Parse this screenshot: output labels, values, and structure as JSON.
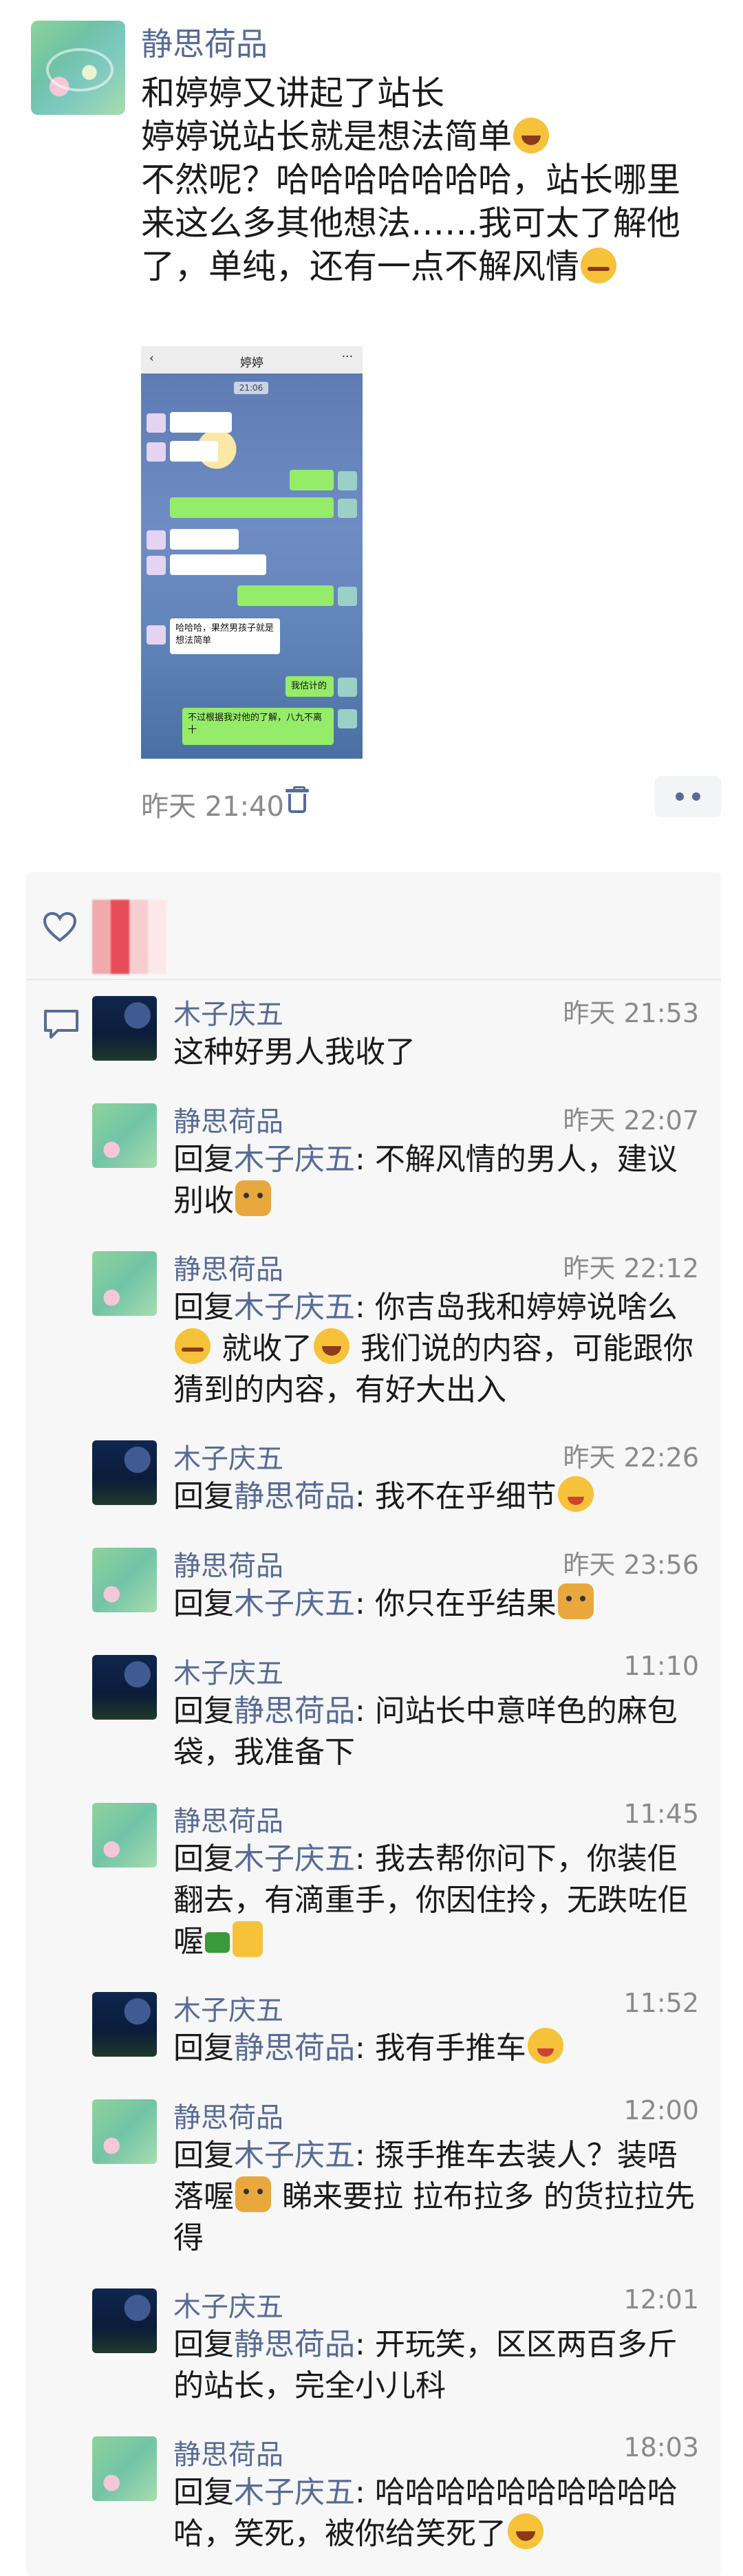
{
  "post": {
    "author": "静思荷品",
    "line1": "和婷婷又讲起了站长",
    "line2": "婷婷说站长就是想法简单",
    "line3": "不然呢？哈哈哈哈哈哈哈，站长哪里",
    "line4": "来这么多其他想法……我可太了解他",
    "line5": "了，单纯，还有一点不解风情",
    "time": "昨天 21:40"
  },
  "screenshot": {
    "title": "婷婷",
    "time": "21:06",
    "bubble1": "哈哈哈，果然男孩子就是想法简单",
    "bubble2": "我估计的",
    "bubble3": "不过根据我对他的了解，八九不离十"
  },
  "comments": [
    {
      "name": "木子庆五",
      "time": "昨天 21:53",
      "text": "这种好男人我收了"
    },
    {
      "name": "静思荷品",
      "time": "昨天 22:07",
      "reply_to": "木子庆五",
      "text": "不解风情的男人，建议别收"
    },
    {
      "name": "静思荷品",
      "time": "昨天 22:12",
      "reply_to": "木子庆五",
      "text": "你吉岛我和婷婷说啥么",
      "text2": "就收了",
      "text3": "我们说的内容，可能跟你猜到的内容，有好大出入"
    },
    {
      "name": "木子庆五",
      "time": "昨天 22:26",
      "reply_to": "静思荷品",
      "text": "我不在乎细节"
    },
    {
      "name": "静思荷品",
      "time": "昨天 23:56",
      "reply_to": "木子庆五",
      "text": "你只在乎结果"
    },
    {
      "name": "木子庆五",
      "time": "11:10",
      "reply_to": "静思荷品",
      "text": "问站长中意咩色的麻包袋，我准备下"
    },
    {
      "name": "静思荷品",
      "time": "11:45",
      "reply_to": "木子庆五",
      "text": "我去帮你问下，你装佢翻去，有滴重手，你因住拎，无跌咗佢喔"
    },
    {
      "name": "木子庆五",
      "time": "11:52",
      "reply_to": "静思荷品",
      "text": "我有手推车"
    },
    {
      "name": "静思荷品",
      "time": "12:00",
      "reply_to": "木子庆五",
      "text": "揼手推车去装人？装唔落喔",
      "text2": "睇来要拉 拉布拉多 的货拉拉先得"
    },
    {
      "name": "木子庆五",
      "time": "12:01",
      "reply_to": "静思荷品",
      "text": "开玩笑，区区两百多斤的站长，完全小儿科"
    },
    {
      "name": "静思荷品",
      "time": "18:03",
      "reply_to": "木子庆五",
      "text": "哈哈哈哈哈哈哈哈哈哈哈，笑死，被你给笑死了"
    }
  ],
  "labels": {
    "reply": "回复",
    "colon": ": "
  },
  "colors": {
    "link": "#576b95",
    "meta": "#8a8a8a",
    "panel": "#f7f7f7"
  }
}
